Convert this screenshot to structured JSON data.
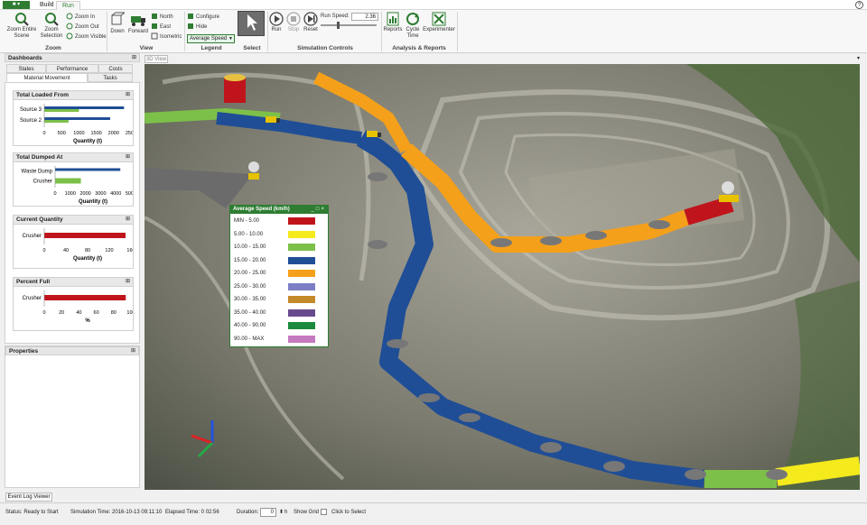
{
  "ribbon_tabs": {
    "build": "Build",
    "run": "Run"
  },
  "ribbon": {
    "zoom": {
      "entire_scene": "Zoom Entire Scene",
      "selection": "Zoom Selection",
      "zoom_in": "Zoom In",
      "zoom_out": "Zoom Out",
      "zoom_visible": "Zoom Visible",
      "group": "Zoom"
    },
    "view": {
      "down": "Down",
      "forward": "Forward",
      "north": "North",
      "east": "East",
      "isometric": "Isometric",
      "group": "View"
    },
    "legend": {
      "configure": "Configure",
      "hide": "Hide",
      "selected": "Average Speed",
      "group": "Legend"
    },
    "select": {
      "individual": "Individual",
      "group": "Select"
    },
    "sim": {
      "run": "Run",
      "stop": "Stop",
      "reset": "Reset",
      "run_speed_label": "Run Speed:",
      "run_speed": "2.36",
      "group": "Simulation Controls"
    },
    "analysis": {
      "reports": "Reports",
      "cycle_time": "Cycle Time",
      "experimenter": "Experimenter",
      "group": "Analysis & Reports"
    }
  },
  "dashboards": {
    "title": "Dashboards",
    "tabs": [
      "States",
      "Performance",
      "Costs",
      "Material Movement",
      "Tasks"
    ],
    "total_loaded": {
      "title": "Total Loaded From",
      "rows": [
        "Source 3",
        "Source 2"
      ],
      "ticks": [
        "0",
        "500",
        "1000",
        "1500",
        "2000",
        "2500"
      ],
      "values": [
        {
          "blue": 2300,
          "green": 1000
        },
        {
          "blue": 1900,
          "green": 700
        }
      ],
      "axis": "Quantity (t)"
    },
    "total_dumped": {
      "title": "Total Dumped At",
      "rows": [
        "Waste Dump",
        "Crusher"
      ],
      "ticks": [
        "0",
        "1000",
        "2000",
        "3000",
        "4000",
        "5000"
      ],
      "values": [
        {
          "blue": 4300,
          "green": 0
        },
        {
          "blue": 0,
          "green": 1700
        }
      ],
      "axis": "Quantity (t)"
    },
    "current_quantity": {
      "title": "Current Quantity",
      "rows": [
        "Crusher"
      ],
      "ticks": [
        "0",
        "40",
        "80",
        "120",
        "160"
      ],
      "value": 150,
      "axis": "Quantity (t)"
    },
    "percent_full": {
      "title": "Percent Full",
      "rows": [
        "Crusher"
      ],
      "ticks": [
        "0",
        "20",
        "40",
        "60",
        "80",
        "100"
      ],
      "value": 94,
      "axis": "%"
    }
  },
  "properties": {
    "title": "Properties"
  },
  "viewport": {
    "tab": "3D View"
  },
  "speed_legend": {
    "title": "Average Speed (km/h)",
    "items": [
      {
        "label": "MIN - 5.00",
        "color": "#c0141c"
      },
      {
        "label": "5.00 - 10.00",
        "color": "#f4ea1c"
      },
      {
        "label": "10.00 - 15.00",
        "color": "#7cc04a"
      },
      {
        "label": "15.00 - 20.00",
        "color": "#1f4e96"
      },
      {
        "label": "20.00 - 25.00",
        "color": "#f5a01a"
      },
      {
        "label": "25.00 - 30.00",
        "color": "#7d7fc4"
      },
      {
        "label": "30.00 - 35.00",
        "color": "#c48a2a"
      },
      {
        "label": "35.00 - 40.00",
        "color": "#6a4a8e"
      },
      {
        "label": "40.00 - 90.00",
        "color": "#1c8a3c"
      },
      {
        "label": "90.00 - MAX",
        "color": "#c57ac0"
      }
    ]
  },
  "bottom": {
    "event_log": "Event Log Viewer"
  },
  "status": {
    "state": "Status: Ready to Start",
    "sim_time": "Simulation Time: 2016-10-13 09:11:10",
    "elapsed": "Elapsed Time: 0 02:56",
    "duration_label": "Duration:",
    "duration_value": "0",
    "duration_unit": "h",
    "show_grid": "Show Grid",
    "click_select": "Click to Select"
  }
}
